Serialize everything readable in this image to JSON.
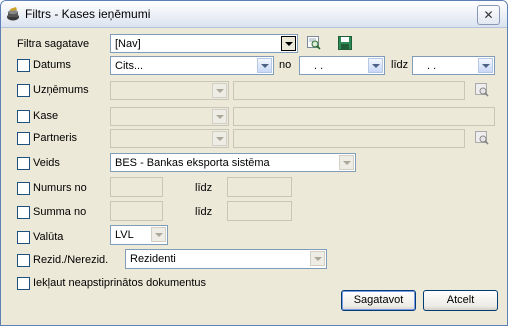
{
  "window": {
    "title": "Filtrs - Kases ieņēmumi",
    "close_label": "✕"
  },
  "filter_template": {
    "label": "Filtra sagatave",
    "value": "[Nav]"
  },
  "rows": {
    "datums": {
      "label": "Datums",
      "select": "Cits...",
      "no_label": "no",
      "from": ". .",
      "lidz_label": "līdz",
      "to": ". ."
    },
    "uznemums": {
      "label": "Uzņēmums"
    },
    "kase": {
      "label": "Kase"
    },
    "partneris": {
      "label": "Partneris"
    },
    "veids": {
      "label": "Veids",
      "value": "BES - Bankas eksporta sistēma"
    },
    "numurs": {
      "label": "Numurs no",
      "lidz_label": "līdz"
    },
    "summa": {
      "label": "Summa no",
      "lidz_label": "līdz"
    },
    "valuta": {
      "label": "Valūta",
      "value": "LVL"
    },
    "rezid": {
      "label": "Rezid./Nerezid.",
      "value": "Rezidenti"
    },
    "iekl": {
      "label": "Iekļaut neapstiprinātos dokumentus"
    }
  },
  "buttons": {
    "ok": "Sagatavot",
    "cancel": "Atcelt"
  }
}
